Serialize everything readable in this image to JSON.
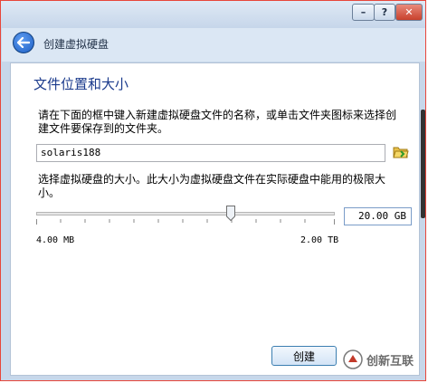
{
  "window": {
    "min_label": "–",
    "help_label": "?",
    "close_label": "✕"
  },
  "header": {
    "title": "创建虚拟硬盘",
    "back_icon": "back-arrow-icon"
  },
  "section": {
    "title": "文件位置和大小",
    "location_description": "请在下面的框中键入新建虚拟硬盘文件的名称，或单击文件夹图标来选择创建文件要保存到的文件夹。",
    "file_name": "solaris188",
    "folder_icon": "folder-icon",
    "size_description": "选择虚拟硬盘的大小。此大小为虚拟硬盘文件在实际硬盘中能用的极限大小。"
  },
  "size": {
    "value": "20.00 GB",
    "min_label": "4.00 MB",
    "max_label": "2.00 TB",
    "slider_level_fraction": 0.65
  },
  "footer": {
    "create_label": "创建"
  },
  "watermark": {
    "text": "创新互联"
  },
  "colors": {
    "accent": "#1a3a8c",
    "border": "#e8463a"
  }
}
